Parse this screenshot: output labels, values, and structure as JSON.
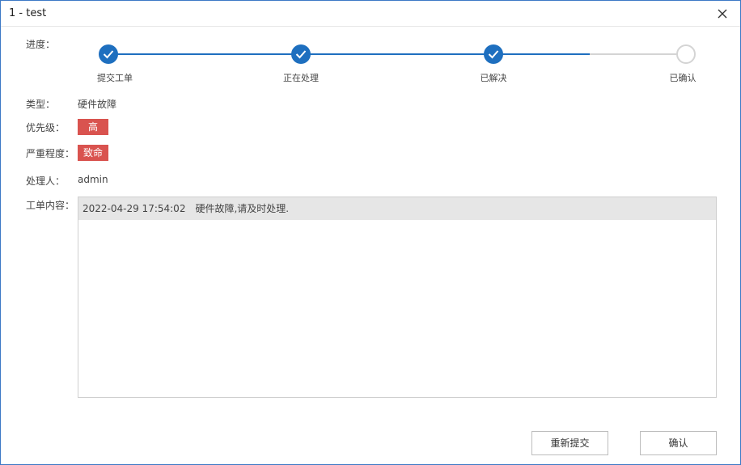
{
  "window": {
    "title": "1 - test"
  },
  "progress": {
    "label": "进度：",
    "steps": [
      {
        "label": "提交工单",
        "done": true
      },
      {
        "label": "正在处理",
        "done": true
      },
      {
        "label": "已解决",
        "done": true
      },
      {
        "label": "已确认",
        "done": false
      }
    ],
    "accent_color": "#1e6fbf",
    "pending_color": "#d4d4d4"
  },
  "fields": {
    "type_label": "类型：",
    "type_value": "硬件故障",
    "priority_label": "优先级：",
    "priority_value": "高",
    "severity_label": "严重程度：",
    "severity_value": "致命",
    "badge_color": "#d9534f",
    "handler_label": "处理人：",
    "handler_value": "admin",
    "content_label": "工单内容："
  },
  "content": {
    "entries": [
      {
        "time": "2022-04-29 17:54:02",
        "text": "硬件故障,请及时处理."
      }
    ]
  },
  "buttons": {
    "resubmit": "重新提交",
    "confirm": "确认"
  }
}
